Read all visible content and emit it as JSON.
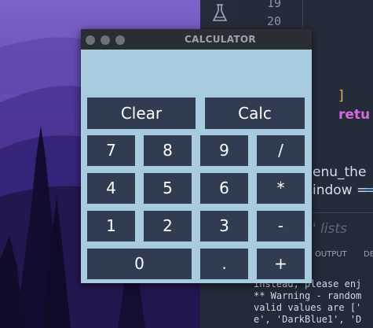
{
  "calculator": {
    "title": "CALCULATOR",
    "display": "",
    "top_buttons": [
      {
        "label": "Clear"
      },
      {
        "label": "Calc"
      }
    ],
    "keys": [
      [
        "7",
        "8",
        "9",
        "/"
      ],
      [
        "4",
        "5",
        "6",
        "*"
      ],
      [
        "1",
        "2",
        "3",
        "-"
      ],
      [
        "0",
        ".",
        "+"
      ]
    ]
  },
  "editor": {
    "line_numbers": [
      "19",
      "20"
    ],
    "code": {
      "bracket": "]",
      "return_kw": "retu",
      "menu_line": "enu_the",
      "window_line": "indow =",
      "comment": "' lists"
    },
    "panel_tabs": [
      "OUTPUT",
      "DE"
    ],
    "terminal_lines": [
      "instead, please enj",
      "** Warning - random",
      "valid values are ['",
      "e', 'DarkBlue1', 'D"
    ]
  },
  "colors": {
    "calc_bg": "#a8cbe0",
    "button_bg": "#2f3c52",
    "titlebar_bg": "#2a2d33"
  }
}
